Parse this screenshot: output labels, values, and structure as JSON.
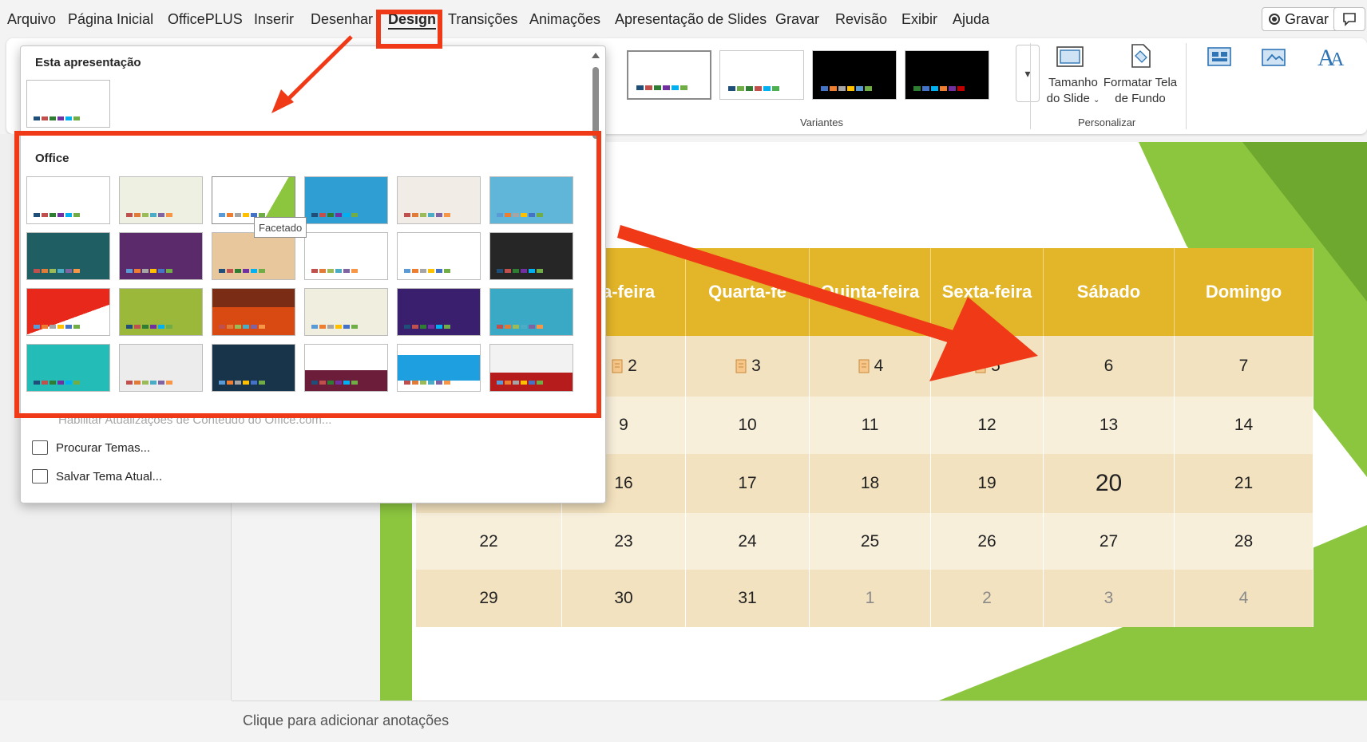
{
  "menu": {
    "tabs": [
      {
        "label": "Arquivo"
      },
      {
        "label": "Página Inicial"
      },
      {
        "label": "OfficePLUS"
      },
      {
        "label": "Inserir"
      },
      {
        "label": "Desenhar"
      },
      {
        "label": "Design"
      },
      {
        "label": "Transições"
      },
      {
        "label": "Animações"
      },
      {
        "label": "Apresentação de Slides"
      },
      {
        "label": "Gravar"
      },
      {
        "label": "Revisão"
      },
      {
        "label": "Exibir"
      },
      {
        "label": "Ajuda"
      }
    ],
    "active_tab": "Design",
    "record_button": "Gravar"
  },
  "ribbon": {
    "variants_label": "Variantes",
    "customize_label": "Personalizar",
    "slide_size": {
      "line1": "Tamanho",
      "line2": "do Slide"
    },
    "format_background": {
      "line1": "Formatar Tela",
      "line2": "de Fundo"
    }
  },
  "theme_panel": {
    "this_presentation": "Esta apresentação",
    "office_heading": "Office",
    "tooltip": "Facetado",
    "commands": {
      "enable_updates": "Habilitar Atualizações de Conteúdo do Office.com...",
      "browse": "Procurar Temas...",
      "save": "Salvar Tema Atual..."
    }
  },
  "calendar": {
    "headers": [
      "ça-feira",
      "Quarta-fe",
      "Quinta-feira",
      "Sexta-feira",
      "Sábado",
      "Domingo"
    ],
    "rows": [
      [
        "",
        "2",
        "3",
        "4",
        "5",
        "6",
        "7"
      ],
      [
        "",
        "9",
        "10",
        "11",
        "12",
        "13",
        "14"
      ],
      [
        "",
        "16",
        "17",
        "18",
        "19",
        "20",
        "21"
      ],
      [
        "22",
        "23",
        "24",
        "25",
        "26",
        "27",
        "28"
      ],
      [
        "29",
        "30",
        "31",
        "1",
        "2",
        "3",
        "4"
      ]
    ]
  },
  "notes": {
    "placeholder": "Clique para adicionar anotações"
  },
  "colors": {
    "accent_red": "#f03a17",
    "calendar_header": "#e3b528",
    "calendar_row_dark": "#f3e2bf",
    "calendar_row_light": "#f8efdb",
    "slide_green": "#8cc63f"
  }
}
